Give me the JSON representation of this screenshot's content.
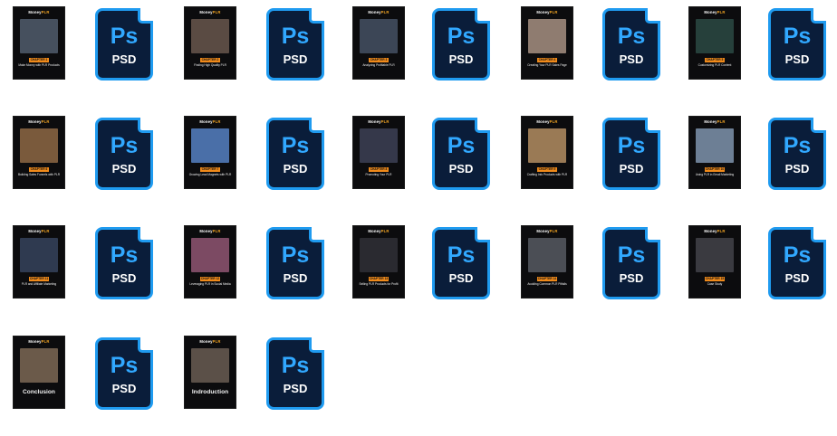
{
  "brand": {
    "name": "Money",
    "suffix": "PLR"
  },
  "psd_icon": {
    "badge": "Ps",
    "extension": "PSD"
  },
  "covers": [
    {
      "chapter": "CHAPTER 1",
      "title": "Make Money with PLR Products",
      "art": "#46505e"
    },
    {
      "chapter": "CHAPTER 2",
      "title": "Finding High Quality PLR",
      "art": "#5a4b43"
    },
    {
      "chapter": "CHAPTER 3",
      "title": "Analyzing Profitable PLR",
      "art": "#3c4656"
    },
    {
      "chapter": "CHAPTER 4",
      "title": "Creating Your PLR Sales Page",
      "art": "#8f7c70"
    },
    {
      "chapter": "CHAPTER 5",
      "title": "Customizing PLR Content",
      "art": "#26403b"
    },
    {
      "chapter": "CHAPTER 6",
      "title": "Building Sales Funnels with PLR",
      "art": "#7a5a3c"
    },
    {
      "chapter": "CHAPTER 7",
      "title": "Growing Lead Magnets with PLR",
      "art": "#4a6fa8"
    },
    {
      "chapter": "CHAPTER 8",
      "title": "Promoting Your PLR",
      "art": "#35384a"
    },
    {
      "chapter": "CHAPTER 9",
      "title": "Crafting Info Products with PLR",
      "art": "#9a7a55"
    },
    {
      "chapter": "CHAPTER 10",
      "title": "Using PLR in Email Marketing",
      "art": "#6d7f95"
    },
    {
      "chapter": "CHAPTER 11",
      "title": "PLR and Affiliate Marketing",
      "art": "#2f3a50"
    },
    {
      "chapter": "CHAPTER 12",
      "title": "Leveraging PLR in Social Media",
      "art": "#7c4a63"
    },
    {
      "chapter": "CHAPTER 13",
      "title": "Selling PLR Products for Profit",
      "art": "#2a2a30"
    },
    {
      "chapter": "CHAPTER 14",
      "title": "Avoiding Common PLR Pitfalls",
      "art": "#4b4e55"
    },
    {
      "chapter": "CHAPTER 15",
      "title": "Case Study",
      "art": "#3a3a40"
    },
    {
      "chapter": "",
      "title": "Conclusion",
      "art": "#6b5a4a"
    },
    {
      "chapter": "",
      "title": "Indroduction",
      "art": "#5b5048"
    }
  ]
}
